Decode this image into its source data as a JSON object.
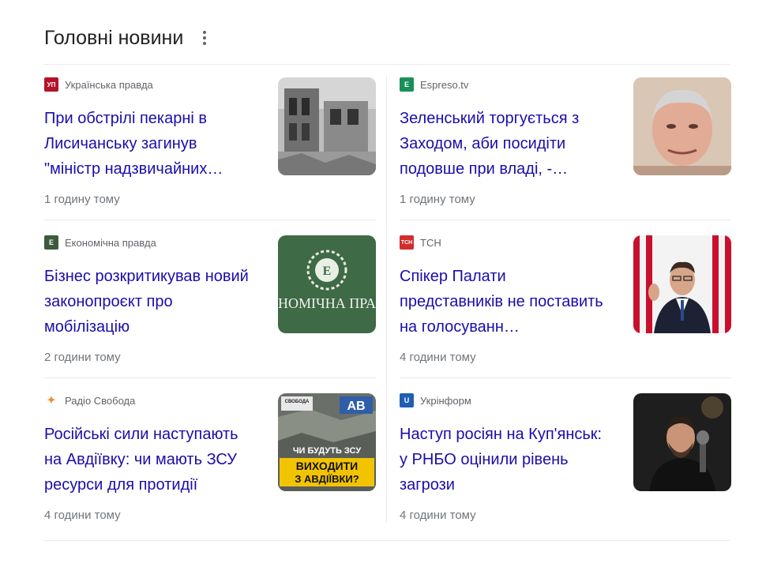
{
  "section": {
    "title": "Головні новини"
  },
  "cards": [
    {
      "source": "Українська правда",
      "logo": "УП",
      "logo_color": "#b3132b",
      "headline": "При обстрілі пекарні в Лисичанську загинув \"міністр надзвичайних…",
      "time": "1 годину тому",
      "thumb": "destroyed-building-photo"
    },
    {
      "source": "Espreso.tv",
      "logo": "E",
      "logo_color": "#1b8f5a",
      "headline": "Зеленський торгується з Заходом, аби посидіти подовше при владі, -…",
      "time": "1 годину тому",
      "thumb": "man-portrait-photo"
    },
    {
      "source": "Економічна правда",
      "logo": "E",
      "logo_color": "#3c5a3c",
      "headline": "Бізнес розкритикував новий законопроєкт про мобілізацію",
      "time": "2 години тому",
      "thumb": "ekonomichna-pravda-logo-image",
      "thumb_text": "НОМІЧНА ПРА"
    },
    {
      "source": "ТСН",
      "logo": "ТСН",
      "logo_color": "#d22d2d",
      "headline": "Спікер Палати представників не поставить на голосуванн…",
      "time": "4 години тому",
      "thumb": "speaker-podium-photo"
    },
    {
      "source": "Радіо Свобода",
      "logo": "✦",
      "logo_color": "#f0882c",
      "headline": "Російські сили наступають на Авдіївку: чи мають ЗСУ ресурси для протидії",
      "time": "4 години тому",
      "thumb": "avdiivka-video-thumbnail",
      "thumb_lines": [
        "СВОБОДА",
        "ЧИ БУДУТЬ ЗСУ",
        "ВИХОДИТИ",
        "З АВДІЇВКИ?",
        "AB"
      ]
    },
    {
      "source": "Укрінформ",
      "logo": "U",
      "logo_color": "#1f5fb4",
      "headline": "Наступ росіян на Куп'янськ: у РНБО оцінили рівень загрози",
      "time": "4 години тому",
      "thumb": "man-microphone-photo"
    }
  ]
}
